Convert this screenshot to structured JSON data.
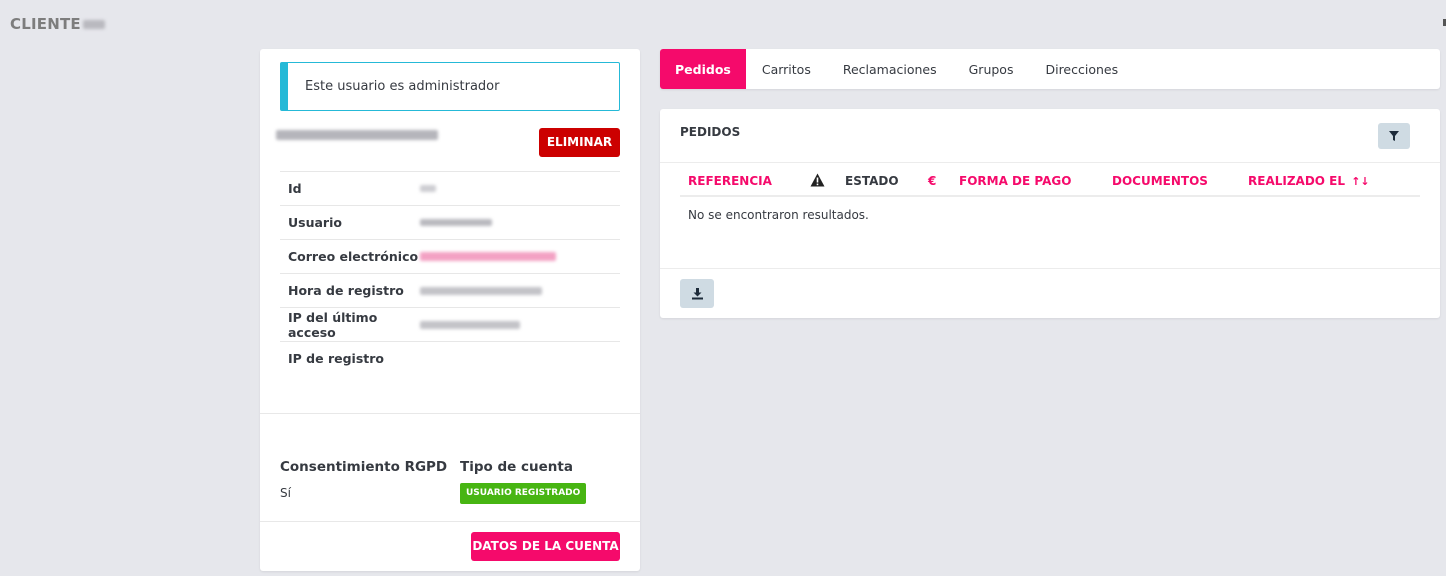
{
  "header": {
    "title": "CLIENTE"
  },
  "customer_card": {
    "admin_notice": "Este usuario es administrador",
    "delete_label": "ELIMINAR",
    "fields": [
      {
        "label": "Id"
      },
      {
        "label": "Usuario"
      },
      {
        "label": "Correo electrónico"
      },
      {
        "label": "Hora de registro"
      },
      {
        "label": "IP del último acceso"
      },
      {
        "label": "IP de registro"
      }
    ],
    "gdpr": {
      "heading": "Consentimiento RGPD",
      "value": "Sí"
    },
    "account_type": {
      "heading": "Tipo de cuenta",
      "badge": "USUARIO REGISTRADO",
      "badge_color": "#47b512"
    },
    "account_data_label": "DATOS DE LA CUENTA"
  },
  "tabs": [
    {
      "label": "Pedidos",
      "active": true
    },
    {
      "label": "Carritos"
    },
    {
      "label": "Reclamaciones"
    },
    {
      "label": "Grupos"
    },
    {
      "label": "Direcciones"
    }
  ],
  "orders": {
    "title": "PEDIDOS",
    "columns": {
      "reference": "REFERENCIA",
      "warning_icon": "warning-icon",
      "status": "ESTADO",
      "currency_symbol": "€",
      "payment": "FORMA DE PAGO",
      "documents": "DOCUMENTOS",
      "date": "REALIZADO EL"
    },
    "empty_message": "No se encontraron resultados.",
    "filter_icon": "filter-icon",
    "export_icon": "download-icon"
  },
  "colors": {
    "accent": "#f50a6b",
    "danger": "#cc0000",
    "info": "#25b9d7",
    "background": "#e6e7ec"
  }
}
